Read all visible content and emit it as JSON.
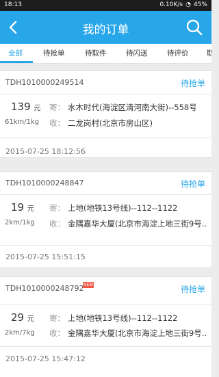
{
  "status_bar": {
    "time": "18:13",
    "net": "0.10K/s",
    "battery": "45%"
  },
  "app": {
    "title": "我的订单"
  },
  "tabs": [
    "全部",
    "待抢单",
    "待取件",
    "待闪送",
    "待评价",
    "取"
  ],
  "active_tab": 0,
  "currency_unit": "元",
  "labels": {
    "sender": "寄：",
    "receiver": "收："
  },
  "orders": [
    {
      "id": "TDH1010000249514",
      "status": "待抢单",
      "price": "139",
      "distance_weight": "61km/1kg",
      "sender": "水木时代(海淀区清河南大街)--558号",
      "receiver": "二龙岗村(北京市房山区)",
      "datetime": "2015-07-25 18:12:56",
      "new": false
    },
    {
      "id": "TDH1010000248847",
      "status": "待抢单",
      "price": "19",
      "distance_weight": "2km/1kg",
      "sender": "上地(地铁13号线)--112--1122",
      "receiver": "金隅嘉华大厦(北京市海淀上地三街9号…",
      "datetime": "2015-07-25 15:51:15",
      "new": false
    },
    {
      "id": "TDH1010000248792",
      "status": "待抢单",
      "price": "29",
      "distance_weight": "2km/7kg",
      "sender": "上地(地铁13号线)--112--1122",
      "receiver": "金隅嘉华大厦(北京市海淀上地三街9号…",
      "datetime": "2015-07-25 15:47:12",
      "new": true,
      "badge": "NEW"
    }
  ]
}
